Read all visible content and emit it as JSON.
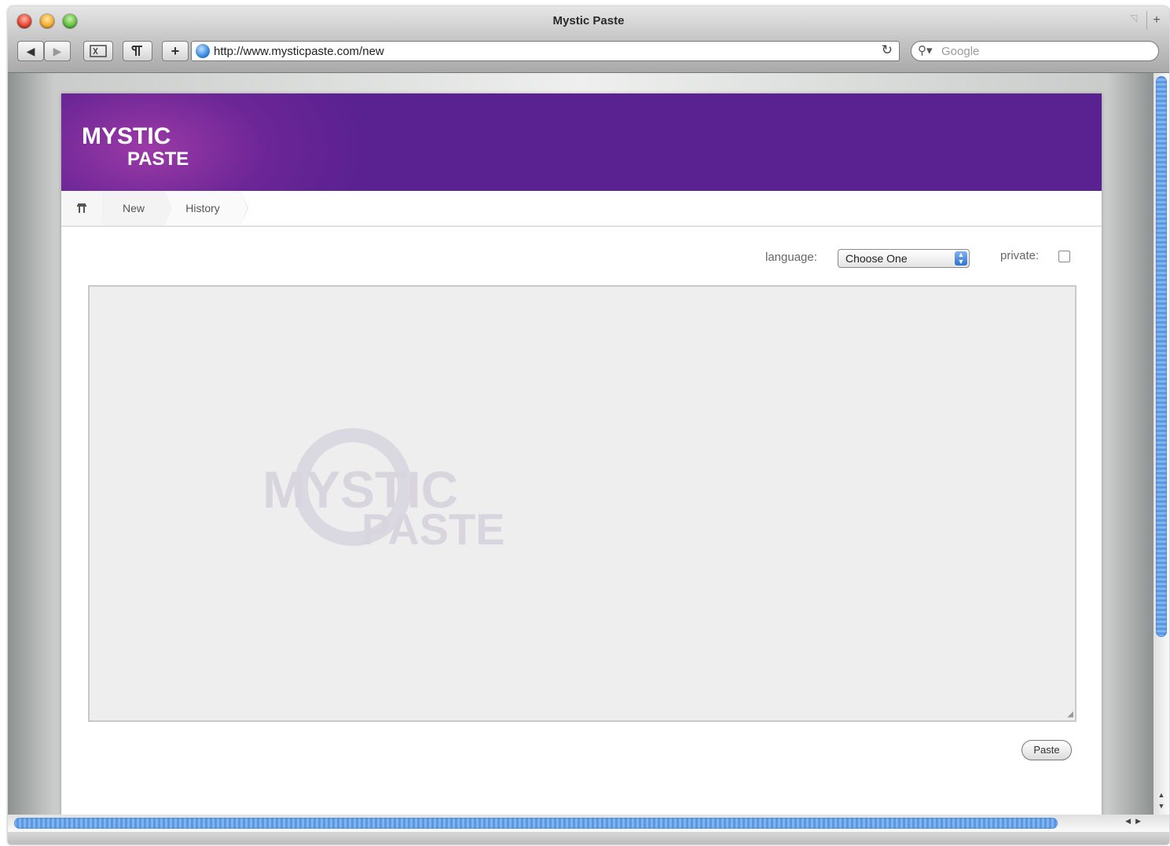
{
  "window": {
    "title": "Mystic Paste"
  },
  "toolbar": {
    "back_glyph": "◀",
    "forward_glyph": "▶",
    "add_glyph": "+",
    "url": "http://www.mysticpaste.com/new",
    "search_placeholder": "Google"
  },
  "header": {
    "logo_line1": "MYSTIC",
    "logo_line2": "PASTE"
  },
  "nav": {
    "items": [
      {
        "label": "New"
      },
      {
        "label": "History"
      }
    ]
  },
  "form": {
    "language_label": "language:",
    "language_value": "Choose One",
    "private_label": "private:",
    "paste_button": "Paste"
  },
  "watermark": {
    "line1": "MYSTIC",
    "line2": "PASTE"
  },
  "colors": {
    "banner": "#5a2190",
    "scroll_thumb": "#5b98e2"
  }
}
